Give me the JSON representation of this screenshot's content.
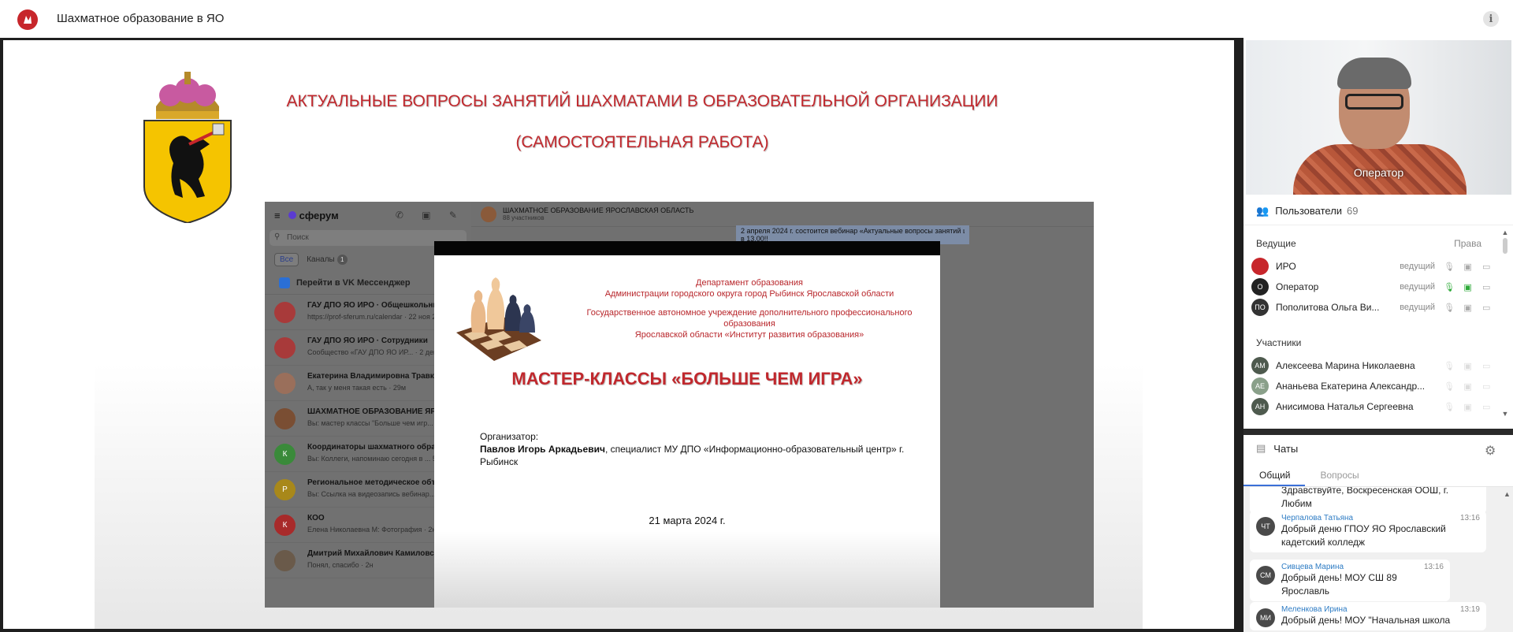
{
  "topbar": {
    "title": "Шахматное образование в ЯО",
    "info_icon": "info-icon"
  },
  "slide": {
    "title_line1": "АКТУАЛЬНЫЕ ВОПРОСЫ ЗАНЯТИЙ ШАХМАТАМИ  В ОБРАЗОВАТЕЛЬНОЙ ОРГАНИЗАЦИИ",
    "title_line2": "(САМОСТОЯТЕЛЬНАЯ РАБОТА)",
    "accent_color": "#c0282d"
  },
  "sferum": {
    "app_name": "сферум",
    "search_placeholder": "Поиск",
    "tab_all": "Все",
    "tab_channels": "Каналы",
    "channels_badge": "1",
    "vk_link": "Перейти в VK Мессенджер",
    "chat_title": "ШАХМАТНОЕ ОБРАЗОВАНИЕ ЯРОСЛАВСКАЯ ОБЛАСТЬ",
    "chat_members": "88 участников",
    "pinned_msg": "2 апреля 2024 г. состоится вебинар «Актуальные вопросы занятий шахм...",
    "pinned_msg2": "в 13.00!!",
    "items": [
      {
        "name": "ГАУ ДПО ЯО ИРО · Общешкольный канал",
        "preview": "https://prof-sferum.ru/calendar · 22 ноя 2022",
        "color": "#a83a3a"
      },
      {
        "name": "ГАУ ДПО ЯО ИРО · Сотрудники",
        "preview": "Сообщество «ГАУ ДПО ЯО ИР... · 2 дек 2021",
        "color": "#a83a3a"
      },
      {
        "name": "Екатерина Владимировна Травкина",
        "preview": "А, так у меня такая есть · 29м",
        "color": "#9a6f5b"
      },
      {
        "name": "ШАХМАТНОЕ ОБРАЗОВАНИЕ ЯРОСЛАВС...",
        "preview": "Вы: мастер классы \"Больше чем игр... 50м",
        "color": "#7a4e33"
      },
      {
        "name": "Координаторы шахматного образовани...",
        "preview": "Вы: Коллеги, напоминаю сегодня в ... 57м",
        "color": "#3a8a3a",
        "letter": "К"
      },
      {
        "name": "Региональное методическое объединен...",
        "preview": "Вы: Ссылка на видеозапись вебинар... 4д",
        "color": "#a8881a",
        "letter": "Р"
      },
      {
        "name": "КОО",
        "preview": "Елена Николаевна М: Фотография · 2н",
        "color": "#a82a2a",
        "letter": "К"
      },
      {
        "name": "Дмитрий Михайлович Камиловский",
        "preview": "Понял, спасибо · 2н",
        "color": "#6a5a4a"
      }
    ]
  },
  "poster": {
    "dep_line1": "Департамент образования",
    "dep_line2": "Администрации  городского округа город Рыбинск Ярославской области",
    "inst_line1": "Государственное автономное учреждение дополнительного профессионального образования",
    "inst_line2": "Ярославской области «Институт развития образования»",
    "master": "МАСТЕР-КЛАССЫ «БОЛЬШЕ ЧЕМ ИГРА»",
    "org_label": "Организатор:",
    "org_name": "Павлов Игорь Аркадьевич",
    "org_desc": ", специалист МУ ДПО «Информационно-образовательный центр» г. Рыбинск",
    "date": "21 марта 2024 г."
  },
  "video": {
    "label": "Оператор"
  },
  "users": {
    "title": "Пользователи",
    "count": "69",
    "hosts_label": "Ведущие",
    "rights_label": "Права",
    "participants_label": "Участники",
    "hosts": [
      {
        "name": "ИРО",
        "role": "ведущий",
        "initials": "",
        "color": "#c7262b"
      },
      {
        "name": "Оператор",
        "role": "ведущий",
        "initials": "О",
        "color": "#222222"
      },
      {
        "name": "Пополитова Ольга Ви...",
        "role": "ведущий",
        "initials": "ПО",
        "color": "#333333"
      }
    ],
    "participants": [
      {
        "name": "Алексеева Марина Николаевна",
        "initials": "АМ",
        "color": "#4e5a4e"
      },
      {
        "name": "Ананьева Екатерина Александр...",
        "initials": "АЕ",
        "color": "#8aa08a"
      },
      {
        "name": "Анисимова Наталья Сергеевна",
        "initials": "АН",
        "color": "#4e5a4e"
      }
    ]
  },
  "chats": {
    "title": "Чаты",
    "tab_general": "Общий",
    "tab_questions": "Вопросы",
    "messages": [
      {
        "text": "Здравствуйте, Воскресенская ООШ, г. Любим"
      },
      {
        "initials": "ЧТ",
        "author": "Черпалова Татьяна",
        "time": "13:16",
        "text": "Добрый деню ГПОУ ЯО Ярославский кадетский колледж"
      },
      {
        "initials": "СМ",
        "author": "Сивцева Марина",
        "time": "13:16",
        "text": "Добрый день! МОУ СШ 89 Ярославль"
      },
      {
        "initials": "МИ",
        "author": "Меленкова Ирина",
        "time": "13:19",
        "text": "Добрый день! МОУ \"Начальная школа"
      }
    ]
  }
}
